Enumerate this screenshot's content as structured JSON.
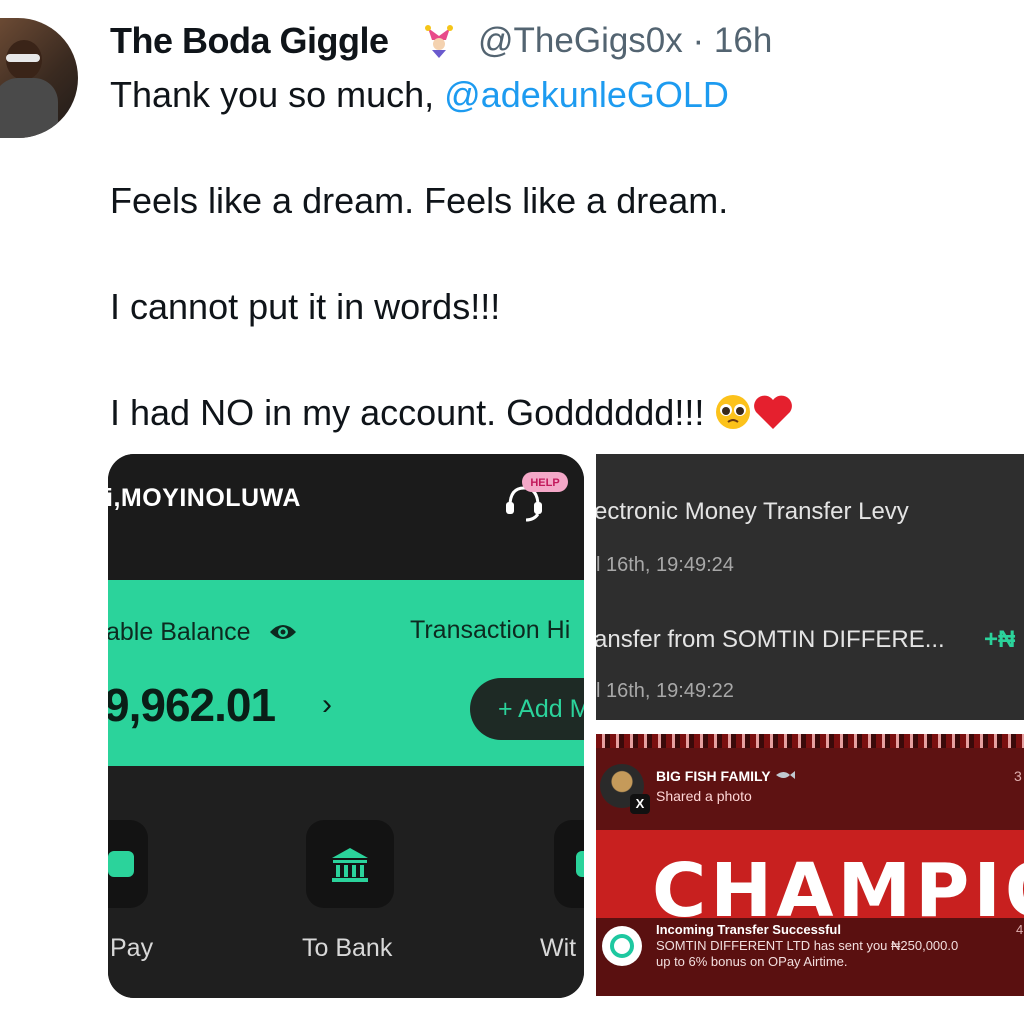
{
  "tweet": {
    "author_name": "The Boda Giggle",
    "handle": "@TheGigs0x",
    "separator": "·",
    "time": "16h",
    "line1_prefix": "Thank you so much, ",
    "line1_mention": "@adekunleGOLD",
    "line2": "Feels like a dream. Feels like a dream.",
    "line3": "I cannot put it in words!!!",
    "line4": "I had NO in my account. Godddddd!!!",
    "emojis": [
      "pleading-face-emoji",
      "red-heart-emoji"
    ],
    "badge_icon": "jester-badge-icon"
  },
  "opay_screen": {
    "greeting_name": "i,MOYINOLUWA",
    "help_label": "HELP",
    "available_balance_label": "able Balance",
    "transaction_history_label": "Transaction Hi",
    "balance": "9,962.01",
    "balance_chevron": "›",
    "add_money_label": "+ Add M",
    "actions": [
      {
        "label": "Pay"
      },
      {
        "label": "To Bank"
      },
      {
        "label": "Wit"
      }
    ],
    "accent_color": "#2bd39b"
  },
  "transactions_crop": {
    "items": [
      {
        "title": "ectronic Money Transfer Levy",
        "time": "l 16th, 19:49:24",
        "amount": ""
      },
      {
        "title": "ansfer from SOMTIN DIFFERE...",
        "time": "l 16th, 19:49:22",
        "amount": "+₦"
      }
    ]
  },
  "notifications_crop": {
    "notif1_title": "BIG FISH FAMILY",
    "notif1_sub": "Shared a photo",
    "notif1_time": "3",
    "background_text": "CHAMPIO",
    "notif2_title": "Incoming Transfer Successful",
    "notif2_line1": "SOMTIN DIFFERENT LTD has sent you ₦250,000.0",
    "notif2_line2": "up to 6% bonus on OPay Airtime.",
    "notif2_time": "4"
  }
}
